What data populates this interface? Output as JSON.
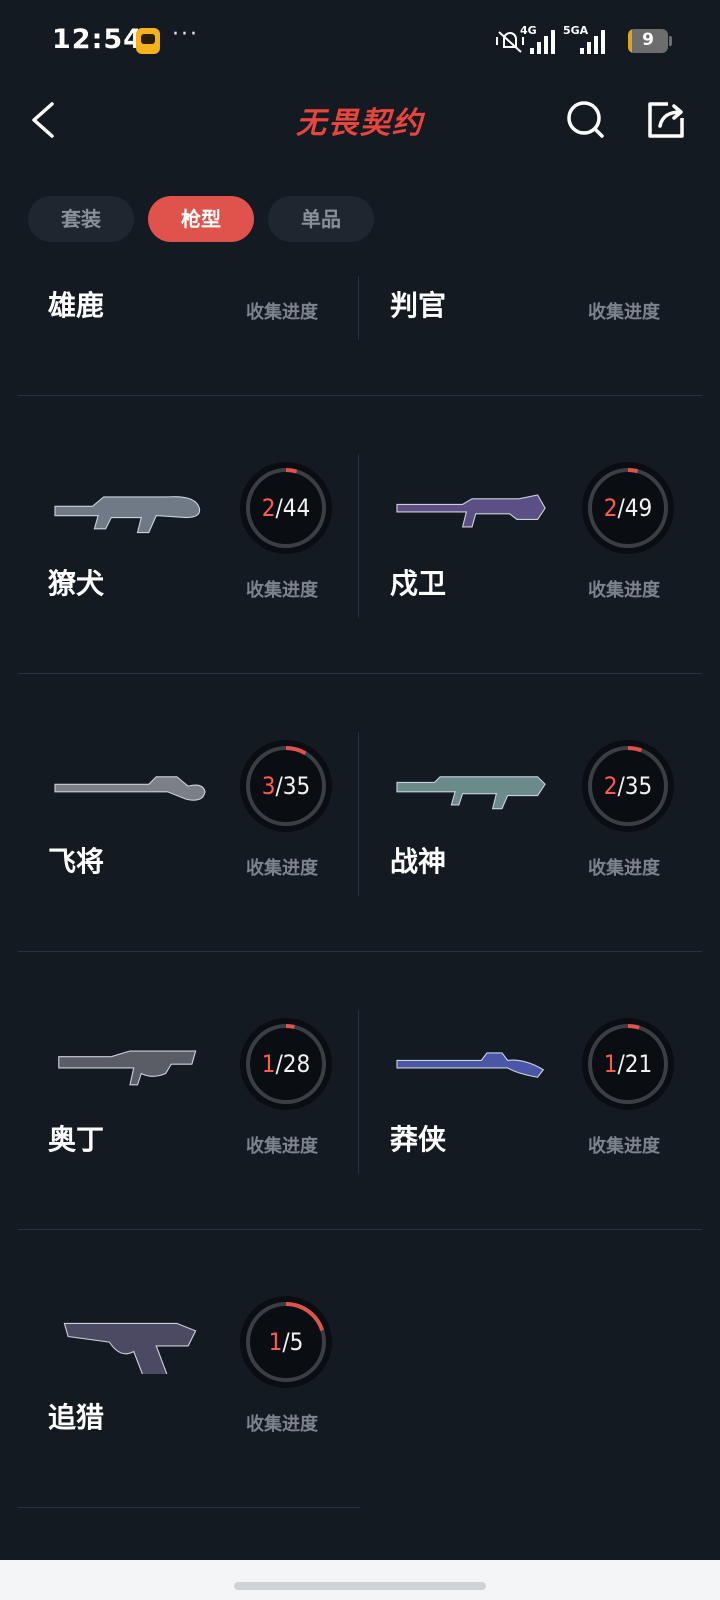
{
  "status_bar": {
    "time": "12:54",
    "dots": "···",
    "net1": "4G",
    "net2": "5GA",
    "battery": "9",
    "battery_level": 0.09,
    "icons": [
      "app-notification-icon",
      "mute-vibrate-icon",
      "signal-icon",
      "battery-icon"
    ]
  },
  "header": {
    "title": "无畏契约",
    "icons": [
      "back-icon",
      "search-icon",
      "share-icon"
    ]
  },
  "tabs": [
    {
      "label": "套装",
      "active": false
    },
    {
      "label": "枪型",
      "active": true
    },
    {
      "label": "单品",
      "active": false
    }
  ],
  "colors": {
    "accent": "#e0534c",
    "background": "#141a22",
    "ring_track": "#3a3f46"
  },
  "progress_label": "收集进度",
  "weapons": [
    {
      "name": "雄鹿",
      "have": "",
      "total": "",
      "partial": true
    },
    {
      "name": "判官",
      "have": "",
      "total": "",
      "partial": true
    },
    {
      "name": "獠犬",
      "have": "2",
      "total": "44"
    },
    {
      "name": "戍卫",
      "have": "2",
      "total": "49"
    },
    {
      "name": "飞将",
      "have": "3",
      "total": "35"
    },
    {
      "name": "战神",
      "have": "2",
      "total": "35"
    },
    {
      "name": "奥丁",
      "have": "1",
      "total": "28"
    },
    {
      "name": "莽侠",
      "have": "1",
      "total": "21"
    },
    {
      "name": "追猎",
      "have": "1",
      "total": "5"
    }
  ]
}
